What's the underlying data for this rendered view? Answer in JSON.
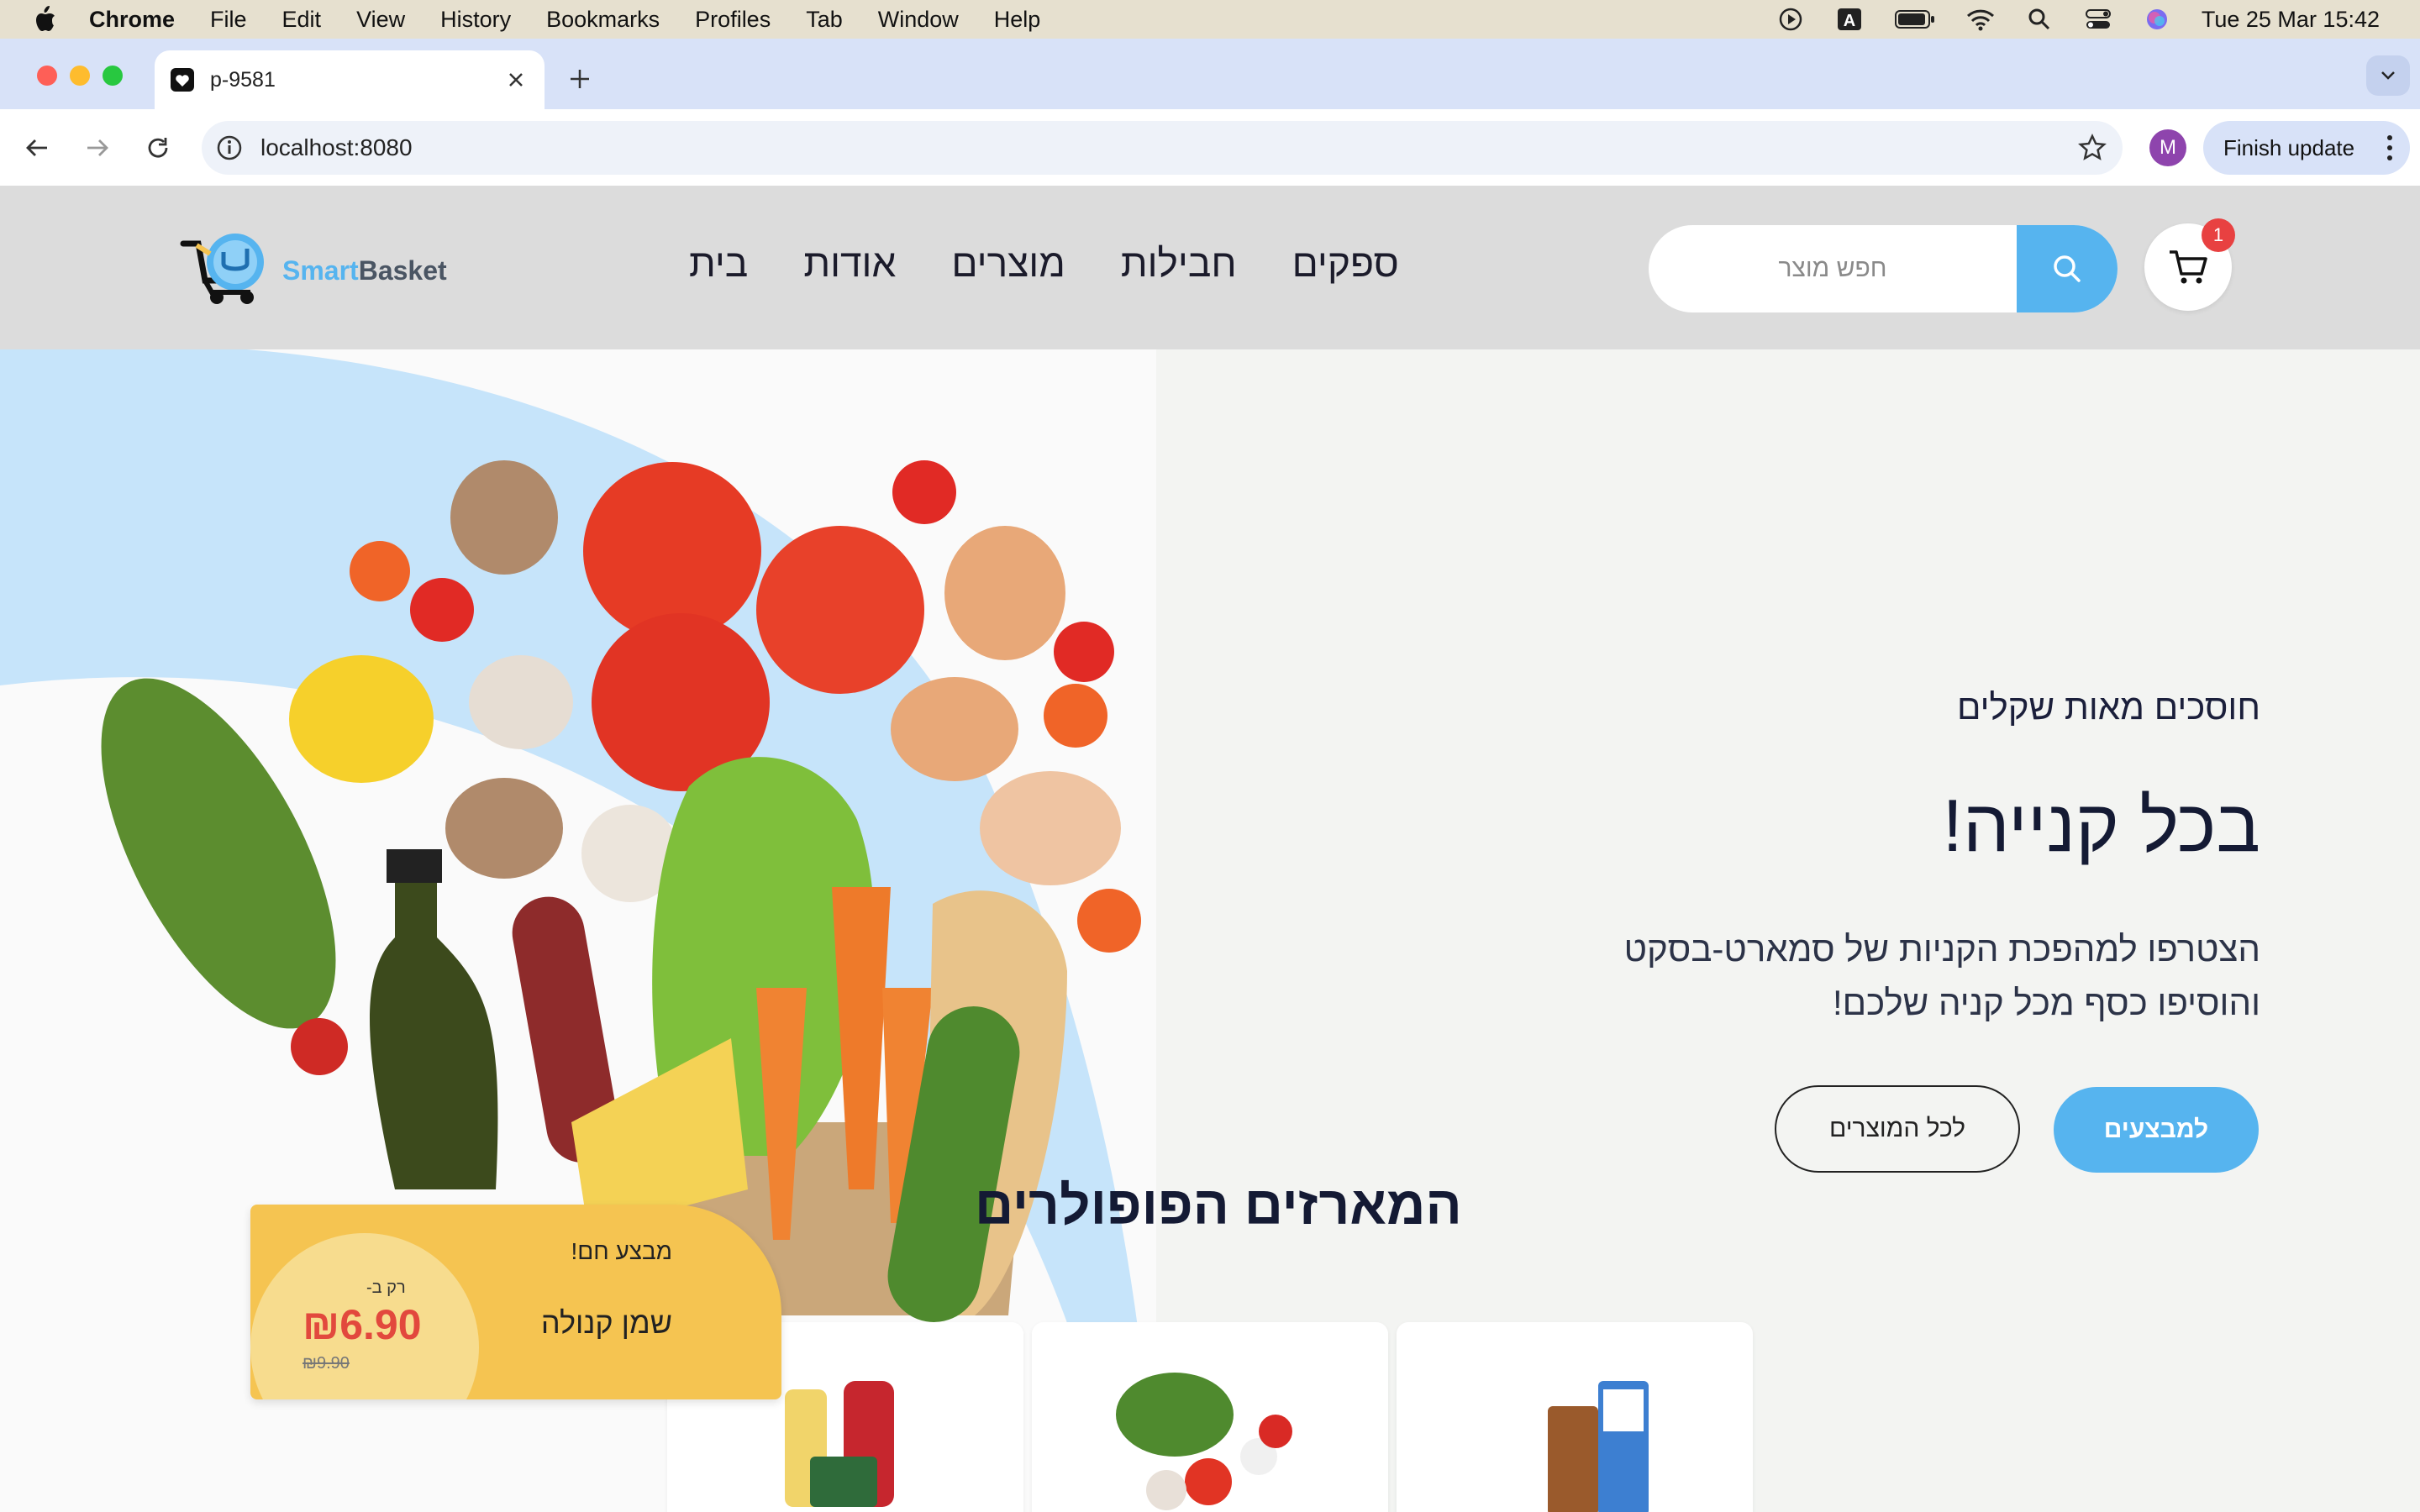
{
  "menubar": {
    "app": "Chrome",
    "items": [
      "File",
      "Edit",
      "View",
      "History",
      "Bookmarks",
      "Profiles",
      "Tab",
      "Window",
      "Help"
    ],
    "clock": "Tue 25 Mar  15:42"
  },
  "browser": {
    "tab_title": "p-9581",
    "url": "localhost:8080",
    "profile_initial": "M",
    "finish_update": "Finish update"
  },
  "site": {
    "brand_smart": "Smart",
    "brand_basket": "Basket",
    "nav": [
      "בית",
      "אודות",
      "מוצרים",
      "חבילות",
      "ספקים"
    ],
    "search_placeholder": "חפש מוצר",
    "cart_count": "1",
    "accent_color": "#56b4ef"
  },
  "hero": {
    "kicker": "חוסכים מאות שקלים",
    "title": "בכל קנייה!",
    "desc_line1": "הצטרפו למהפכת הקניות של סמארט-בסקט",
    "desc_line2": "והוסיפו כסף מכל קניה שלכם!",
    "btn_deals": "למבצעים",
    "btn_all": "לכל המוצרים"
  },
  "popular": {
    "title": "המארזים הפופולרים"
  },
  "promo": {
    "label": "מבצע חם!",
    "product": "שמן קנולה",
    "only": "רק ב-",
    "price": "₪6.90",
    "old_price": "₪9.90"
  }
}
